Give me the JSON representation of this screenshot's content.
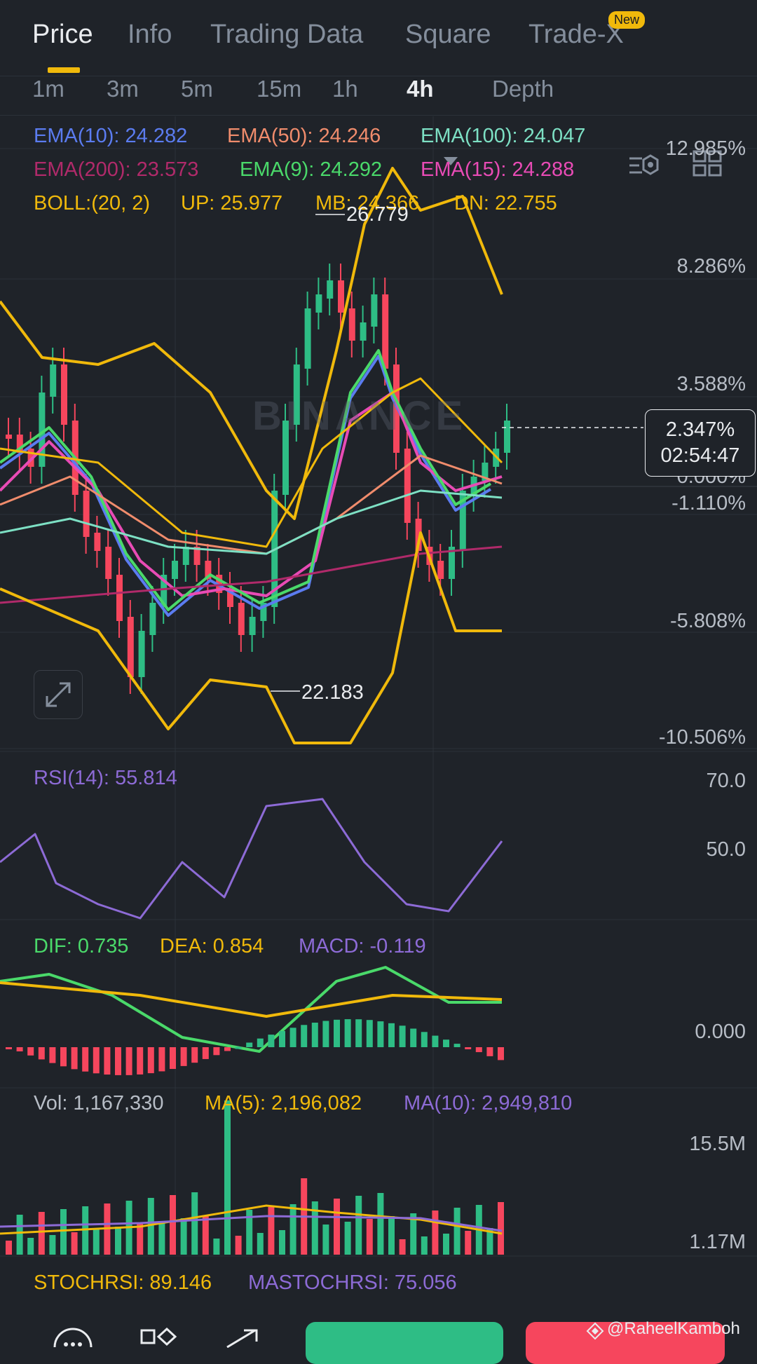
{
  "tabs": [
    {
      "label": "Price",
      "active": true
    },
    {
      "label": "Info"
    },
    {
      "label": "Trading Data"
    },
    {
      "label": "Square"
    },
    {
      "label": "Trade-X"
    }
  ],
  "new_badge": "New",
  "intervals": [
    "1m",
    "3m",
    "5m",
    "15m",
    "1h",
    "4h",
    "Depth"
  ],
  "active_interval": "4h",
  "ema": {
    "e10": "EMA(10): 24.282",
    "e50": "EMA(50): 24.246",
    "e100": "EMA(100): 24.047",
    "e200": "EMA(200): 23.573",
    "e9": "EMA(9): 24.292",
    "e15": "EMA(15): 24.288"
  },
  "boll": {
    "params": "BOLL:(20, 2)",
    "up": "UP: 25.977",
    "mb": "MB: 24.366",
    "dn": "DN: 22.755"
  },
  "price_axis": [
    "12.985%",
    "8.286%",
    "3.588%",
    "0.000%",
    "-1.110%",
    "-5.808%",
    "-10.506%"
  ],
  "current": {
    "percent": "2.347%",
    "countdown": "02:54:47"
  },
  "high_label": "26.779",
  "low_label": "22.183",
  "watermark_logo": "BINANCE",
  "rsi": {
    "label": "RSI(14): 55.814",
    "axis": [
      "70.0",
      "50.0"
    ]
  },
  "macd": {
    "dif": "DIF: 0.735",
    "dea": "DEA: 0.854",
    "macd": "MACD: -0.119",
    "axis": "0.000"
  },
  "vol": {
    "vol": "Vol: 1,167,330",
    "ma5": "MA(5): 2,196,082",
    "ma10": "MA(10): 2,949,810",
    "axis": [
      "15.5M",
      "1.17M"
    ]
  },
  "stoch": {
    "stoch": "STOCHRSI: 89.146",
    "mastoch": "MASTOCHRSI: 75.056"
  },
  "credit": "@RaheelKamboh",
  "colors": {
    "bg": "#1f2329",
    "up": "#2ebd85",
    "down": "#f6465d",
    "ema10": "#5b7cf0",
    "ema50": "#f08c6c",
    "ema100": "#7de0c4",
    "ema200": "#b02a6a",
    "ema9": "#4ad96a",
    "ema15": "#e84bb5",
    "boll": "#f0b90b",
    "rsi": "#8d6bd6"
  }
}
